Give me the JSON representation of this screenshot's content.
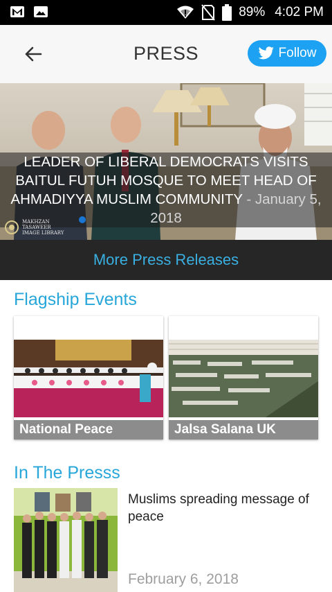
{
  "status_bar": {
    "battery": "89%",
    "time": "4:02 PM",
    "icons": [
      "gmail-icon",
      "image-icon",
      "wifi-icon",
      "no-sim-icon",
      "battery-icon"
    ]
  },
  "app_bar": {
    "title": "PRESS",
    "follow_label": "Follow",
    "icons": [
      "back-arrow-icon",
      "twitter-bird-icon"
    ]
  },
  "hero": {
    "headline": "LEADER OF LIBERAL DEMOCRATS VISITS BAITUL FUTUH MOSQUE TO MEET HEAD OF AHMADIYYA MUSLIM COMMUNITY",
    "separator": " - ",
    "date": "January 5, 2018",
    "watermark_lines": [
      "MAKHZAN",
      "TASAWEER",
      "IMAGE LIBRARY"
    ]
  },
  "more_press": {
    "label": "More Press Releases"
  },
  "flagship": {
    "title": "Flagship Events",
    "cards": [
      {
        "label": "National Peace"
      },
      {
        "label": "Jalsa Salana UK"
      }
    ]
  },
  "in_the_press": {
    "title": "In The Presss",
    "items": [
      {
        "headline": "Muslims spreading message of peace",
        "date": "February 6, 2018"
      }
    ]
  },
  "colors": {
    "accent": "#27a6d9",
    "twitter": "#1da1f2",
    "dark_bar": "#262626",
    "card_label_bg": "#8c8c8c"
  }
}
